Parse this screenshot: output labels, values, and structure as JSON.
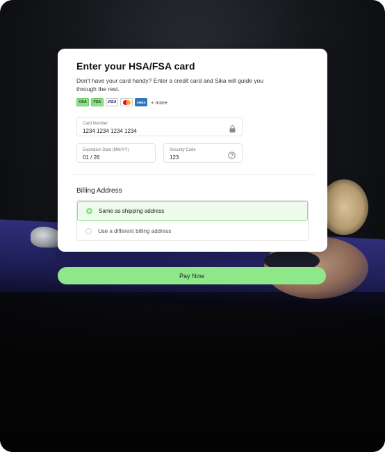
{
  "card": {
    "title": "Enter your HSA/FSA card",
    "subtitle": "Don't have your card handy? Enter a credit card and Sika will guide you through the rest.",
    "badges": {
      "hsa": "HSA",
      "fsa": "FSA",
      "visa": "VISA",
      "amex": "AMEX",
      "more": "+ more"
    },
    "fields": {
      "card_number": {
        "label": "Card Number",
        "value": "1234 1234 1234 1234",
        "icon": "lock-icon"
      },
      "expiration": {
        "label": "Expiration Date (MM/YY)",
        "value": "01 / 26"
      },
      "security": {
        "label": "Security Code",
        "value": "123",
        "icon": "help-circle-icon"
      }
    }
  },
  "billing": {
    "title": "Billing Address",
    "options": [
      {
        "label": "Same as shipping address",
        "selected": true
      },
      {
        "label": "Use a different billing address",
        "selected": false
      }
    ]
  },
  "pay_button": {
    "label": "Pay Now"
  },
  "colors": {
    "accent_green": "#8ee88a",
    "selected_bg": "#edfbeb",
    "background": "#15171b"
  }
}
